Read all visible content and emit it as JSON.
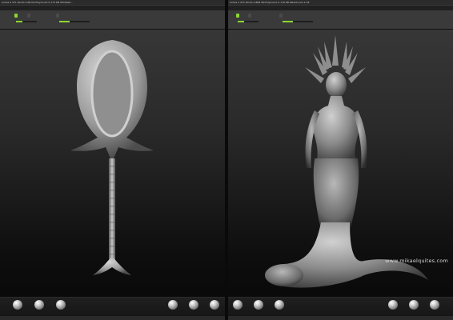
{
  "left_window": {
    "info_bar": "Active 0 2T1  Points 0.68 Mil  PolyCount 0.173 KB 5M  Mesh..."
  },
  "right_window": {
    "info_bar": "Active 0 2T2  Points 0.868 Mil  PolyCount 0.176 KB  MeshCount 2.18",
    "watermark": "www.mikaelquites.com"
  },
  "colors": {
    "accent": "#8ed631",
    "background_top": "#3b3b3b",
    "background_bottom": "#070707"
  }
}
